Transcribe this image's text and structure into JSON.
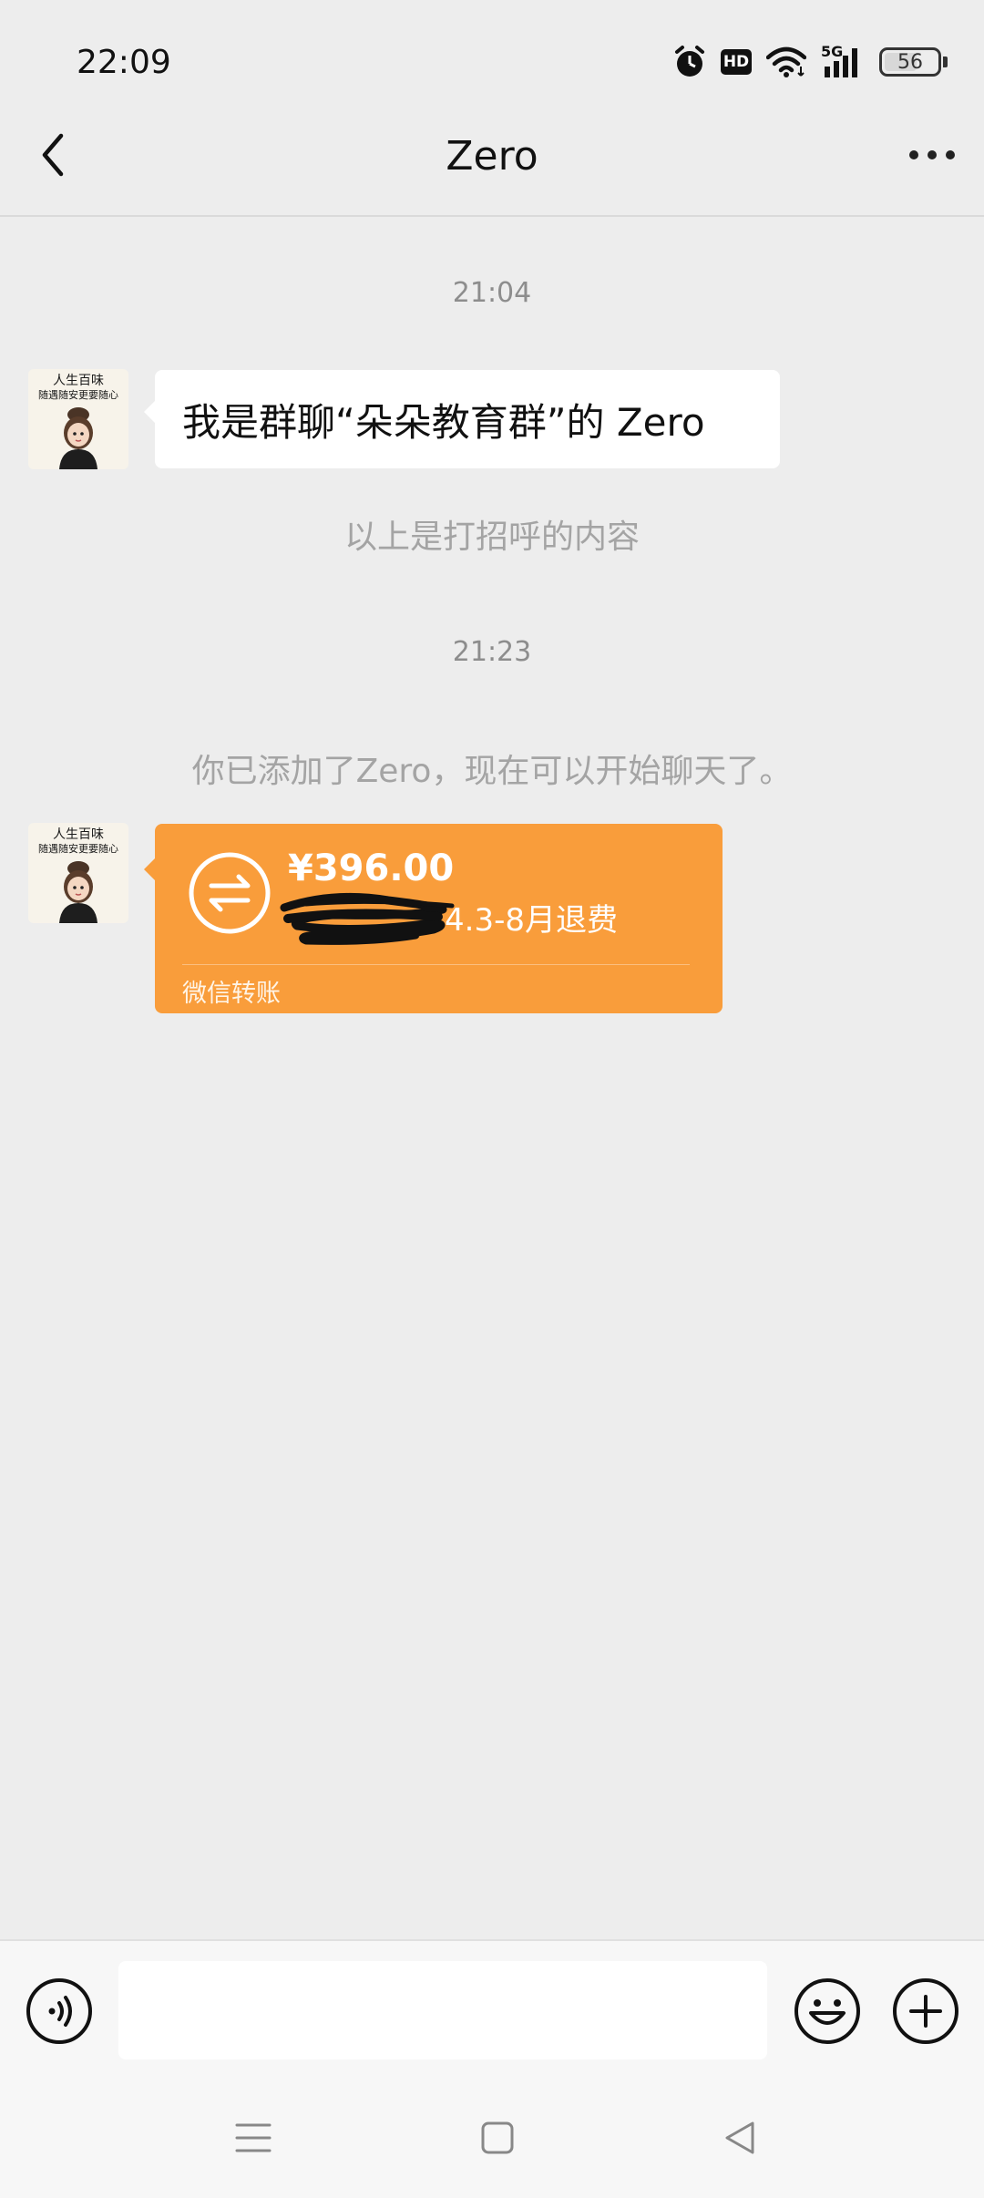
{
  "status_bar": {
    "time": "22:09",
    "hd_label": "HD",
    "network_label": "5G",
    "battery_level": "56"
  },
  "header": {
    "title": "Zero",
    "back_icon": "chevron-left-icon",
    "more_icon": "more-dots-icon"
  },
  "chat": {
    "messages": [
      {
        "type": "timestamp",
        "text": "21:04"
      },
      {
        "type": "text",
        "sender": "Zero",
        "text": "我是群聊“朵朵教育群”的 Zero"
      },
      {
        "type": "system",
        "text": "以上是打招呼的内容"
      },
      {
        "type": "timestamp",
        "text": "21:23"
      },
      {
        "type": "system",
        "text": "你已添加了Zero，现在可以开始聊天了。"
      },
      {
        "type": "transfer",
        "sender": "Zero",
        "amount": "¥396.00",
        "note": "4.3-8月退费",
        "label": "微信转账"
      }
    ]
  },
  "avatar": {
    "line1": "人生百味",
    "line2": "随遇随安更要随心"
  },
  "input_bar": {
    "voice_icon": "voice-icon",
    "message_value": "",
    "emoji_icon": "emoji-icon",
    "plus_icon": "plus-icon"
  },
  "system_nav": {
    "menu_icon": "menu-icon",
    "home_icon": "home-icon",
    "back_icon": "back-triangle-icon"
  },
  "colors": {
    "background": "#ededed",
    "transfer_card": "#f99d3b",
    "bubble": "#ffffff",
    "timestamp_text": "#8d8d8d"
  }
}
